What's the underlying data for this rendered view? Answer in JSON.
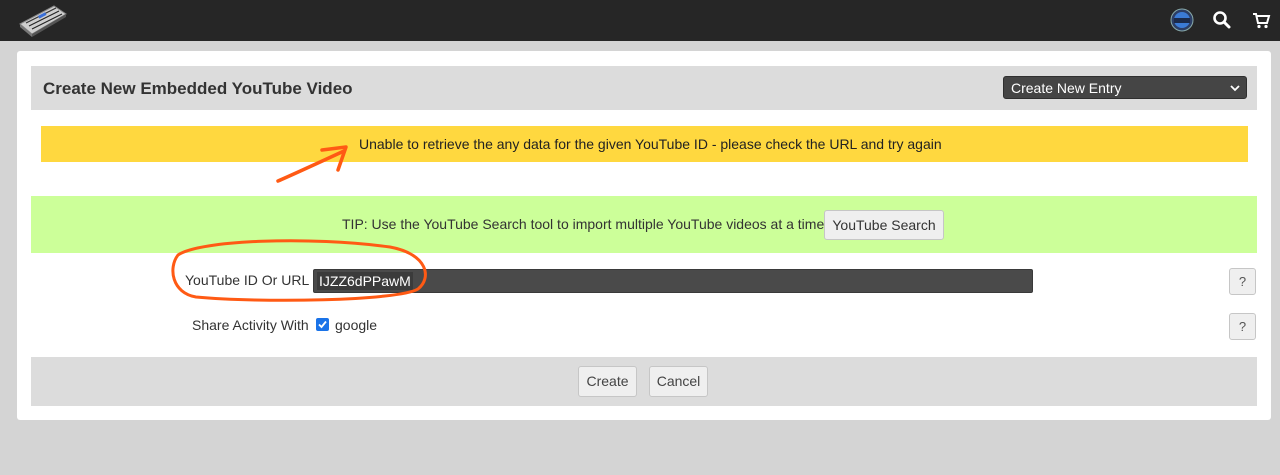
{
  "nav": {
    "logo_icon": "keyboard-synth-logo",
    "icons": [
      "avatar",
      "search-icon",
      "cart-icon"
    ]
  },
  "page": {
    "title": "Create New Embedded YouTube Video",
    "entry_select": "Create New Entry"
  },
  "warning": {
    "message": "Unable to retrieve the any data for the given YouTube ID - please check the URL and try again",
    "color": "#ffd83f"
  },
  "tip": {
    "text": "TIP: Use the YouTube Search tool to import multiple YouTube videos at a time:",
    "button_label": "YouTube Search",
    "color": "#ccff99"
  },
  "form": {
    "youtube_label": "YouTube ID Or URL",
    "youtube_value": "IJZZ6dPPawM",
    "share_label": "Share Activity With",
    "share_option": "google",
    "share_checked": true,
    "help_label": "?"
  },
  "footer": {
    "create_label": "Create",
    "cancel_label": "Cancel"
  },
  "colors": {
    "topbar": "#262626",
    "annotation": "#ff5a14"
  }
}
